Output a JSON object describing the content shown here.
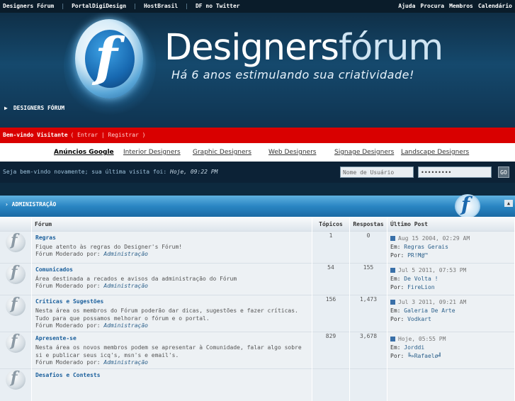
{
  "topbar": {
    "links": [
      "Designers Fórum",
      "PortalDigiDesign",
      "HostBrasil",
      "DF no Twitter"
    ],
    "right_links": [
      "Ajuda",
      "Procura",
      "Membros",
      "Calendário"
    ]
  },
  "header": {
    "brand_main": "Designers",
    "brand_accent": "fórum",
    "tagline": "Há 6 anos estimulando sua criatividade!",
    "breadcrumb": "DESIGNERS FÓRUM",
    "logo_letter": "f"
  },
  "welcome": {
    "text": "Bem-vindo Visitante",
    "links": "( Entrar | Registrar )"
  },
  "ads": {
    "items": [
      "Anúncios Google",
      "Interior Designers",
      "Graphic Designers",
      "Web Designers",
      "Signage Designers",
      "Landscape Designers"
    ]
  },
  "lastvisit": {
    "prefix": "Seja bem-vindo novamente; sua última visita foi:",
    "time": "Hoje, 09:22 PM",
    "username_placeholder": "Nome de Usuário",
    "password_value": "•••••••••",
    "go_label": "GO"
  },
  "category": {
    "title": "ADMINISTRAÇÃO",
    "collapse_icon": "collapse-icon"
  },
  "table": {
    "headers": [
      "Fórum",
      "Tópicos",
      "Respostas",
      "Último Post"
    ],
    "rows": [
      {
        "name": "Regras",
        "desc": "Fique atento às regras do Designer's Fórum!",
        "mod_prefix": "Fórum Moderado por:",
        "mod": "Administração",
        "topics": "1",
        "replies": "0",
        "last_date": "Aug 15 2004, 02:29 AM",
        "last_in_prefix": "Em:",
        "last_in": "Regras Gerais",
        "last_by_prefix": "Por:",
        "last_by": "PR!M@™"
      },
      {
        "name": "Comunicados",
        "desc": "Área destinada a recados e avisos da administração do Fórum",
        "mod_prefix": "Fórum Moderado por:",
        "mod": "Administração",
        "topics": "54",
        "replies": "155",
        "last_date": "Jul 5 2011, 07:53 PM",
        "last_in_prefix": "Em:",
        "last_in": "De Volta !",
        "last_by_prefix": "Por:",
        "last_by": "FireLion"
      },
      {
        "name": "Críticas e Sugestões",
        "desc": "Nesta área os membros do Fórum poderão dar dicas, sugestões e fazer críticas. Tudo para que possamos melhorar o fórum e o portal.",
        "mod_prefix": "Fórum Moderado por:",
        "mod": "Administração",
        "topics": "156",
        "replies": "1,473",
        "last_date": "Jul 3 2011, 09:21 AM",
        "last_in_prefix": "Em:",
        "last_in": "Galeria De Arte",
        "last_by_prefix": "Por:",
        "last_by": "Vodkart"
      },
      {
        "name": "Apresente-se",
        "desc": "Nesta área os novos membros podem se apresentar à Comunidade, falar algo sobre si e publicar seus icq's, msn's e email's.",
        "mod_prefix": "Fórum Moderado por:",
        "mod": "Administração",
        "topics": "829",
        "replies": "3,678",
        "last_date": "Hoje, 05:55 PM",
        "last_in_prefix": "Em:",
        "last_in": "Jorddi",
        "last_by_prefix": "Por:",
        "last_by": "╚»Rafaelø╝"
      },
      {
        "name": "Desafios e Contests",
        "desc": "",
        "mod_prefix": "",
        "mod": "",
        "topics": "",
        "replies": "",
        "last_date": "",
        "last_in_prefix": "",
        "last_in": "",
        "last_by_prefix": "",
        "last_by": ""
      }
    ]
  }
}
